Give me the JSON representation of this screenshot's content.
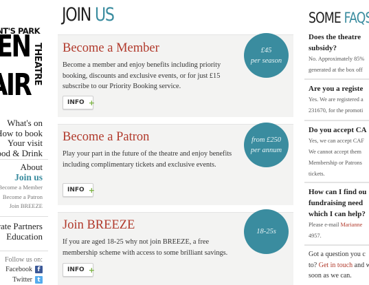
{
  "sidebar": {
    "logo": {
      "line1": "REGENT'S PARK",
      "line2": "OPEN",
      "line3": "AIR",
      "vertical": "THEATRE"
    },
    "nav_main": [
      "What's on",
      "How to book",
      "Your visit",
      "Food & Drink"
    ],
    "nav_about": {
      "about": "About",
      "join_us": "Join us"
    },
    "nav_sub": [
      "Become a Member",
      "Become a Patron",
      "Join BREEZE"
    ],
    "nav_bottom": [
      "Corporate Partners",
      "Education"
    ],
    "follow": "Follow us on:",
    "social": [
      {
        "label": "Facebook",
        "icon": "facebook-icon"
      },
      {
        "label": "Twitter",
        "icon": "twitter-icon"
      }
    ]
  },
  "main": {
    "title_part1": "JOIN",
    "title_part2": "US",
    "cards": [
      {
        "title": "Become a Member",
        "text": "Become a member and enjoy benefits including priority booking, discounts and exclusive events, or for just £15 subscribe to our Priority Booking service.",
        "button": "INFO",
        "badge_line1": "£45",
        "badge_line2": "per season"
      },
      {
        "title": "Become a Patron",
        "text": "Play your part in the future of the theatre and enjoy benefits including complimentary tickets and exclusive events.",
        "button": "INFO",
        "badge_line1": "from £250",
        "badge_line2": "per annum"
      },
      {
        "title": "Join BREEZE",
        "text": "If you are aged 18-25 why not join BREEZE, a free membership scheme with access to some brilliant savings.",
        "button": "INFO",
        "badge_line1": "18-25s",
        "badge_line2": ""
      }
    ]
  },
  "faq": {
    "title_part1": "SOME",
    "title_part2": "FAQS",
    "items": [
      {
        "q1": "Does the theatre",
        "q2": "subsidy?",
        "a1": "No. Approximately 85%",
        "a2": "generated at the box off"
      },
      {
        "q1": "Are you a registe",
        "a1": "Yes. We are registered a",
        "a2": "231670, for the promoti"
      },
      {
        "q1": "Do you accept CA",
        "a1": "Yes, we can accept CAF",
        "a2": "We cannot accept them",
        "a3": "Membership or Patrons",
        "a4": "tickets."
      },
      {
        "q1": "How can I find ou",
        "q2": "fundraising need",
        "q3": "which I can help?",
        "a1_prefix": "Please e-mail ",
        "a1_link": "Marianne",
        "a2": "4957."
      }
    ],
    "closing": {
      "line1": "Got a question you c",
      "line2_prefix": "to? ",
      "line2_link": "Get in touch",
      "line2_suffix": " and w",
      "line3": "soon as we can."
    }
  }
}
